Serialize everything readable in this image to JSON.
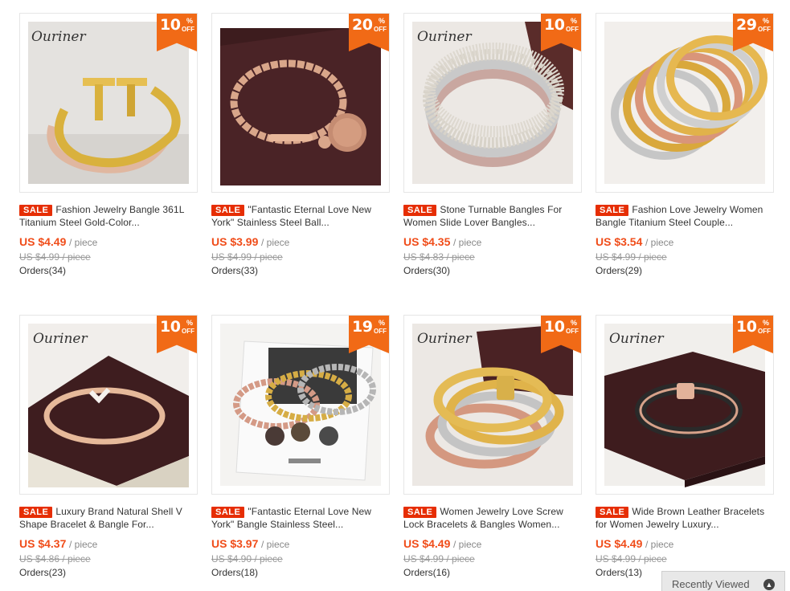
{
  "products": [
    {
      "discount": "10",
      "sale_label": "SALE",
      "title": "Fashion Jewelry Bangle 361L Titanium Steel Gold-Color...",
      "price": "US $4.49",
      "unit": "/ piece",
      "old_price": "US $4.99 / piece",
      "orders": "Orders(34)",
      "brand": "Ouriner",
      "image": "gold-t-bangle"
    },
    {
      "discount": "20",
      "sale_label": "SALE",
      "title": "\"Fantastic Eternal Love New York\" Stainless Steel Ball...",
      "price": "US $3.99",
      "unit": "/ piece",
      "old_price": "US $4.99 / piece",
      "orders": "Orders(33)",
      "brand": "",
      "image": "rose-bead-bracelet"
    },
    {
      "discount": "10",
      "sale_label": "SALE",
      "title": "Stone Turnable Bangles For Women Slide Lover Bangles...",
      "price": "US $4.35",
      "unit": "/ piece",
      "old_price": "US $4.83 / piece",
      "orders": "Orders(30)",
      "brand": "Ouriner",
      "image": "stone-bangles"
    },
    {
      "discount": "29",
      "sale_label": "SALE",
      "title": "Fashion Love Jewelry Women Bangle Titanium Steel Couple...",
      "price": "US $3.54",
      "unit": "/ piece",
      "old_price": "US $4.99 / piece",
      "orders": "Orders(29)",
      "brand": "",
      "image": "screw-bangles"
    },
    {
      "discount": "10",
      "sale_label": "SALE",
      "title": "Luxury Brand Natural Shell V Shape Bracelet & Bangle For...",
      "price": "US $4.37",
      "unit": "/ piece",
      "old_price": "US $4.86 / piece",
      "orders": "Orders(23)",
      "brand": "Ouriner",
      "image": "shell-v-bangle"
    },
    {
      "discount": "19",
      "sale_label": "SALE",
      "title": "\"Fantastic Eternal Love New York\" Bangle Stainless Steel...",
      "price": "US $3.97",
      "unit": "/ piece",
      "old_price": "US $4.90 / piece",
      "orders": "Orders(18)",
      "brand": "",
      "image": "bead-bracelets-set"
    },
    {
      "discount": "10",
      "sale_label": "SALE",
      "title": "Women Jewelry Love Screw Lock Bracelets & Bangles Women...",
      "price": "US $4.49",
      "unit": "/ piece",
      "old_price": "US $4.99 / piece",
      "orders": "Orders(16)",
      "brand": "Ouriner",
      "image": "lock-bangles"
    },
    {
      "discount": "10",
      "sale_label": "SALE",
      "title": "Wide Brown Leather Bracelets for Women Jewelry Luxury...",
      "price": "US $4.49",
      "unit": "/ piece",
      "old_price": "US $4.99 / piece",
      "orders": "Orders(13)",
      "brand": "Ouriner",
      "image": "leather-bangle"
    }
  ],
  "badge": {
    "percent": "%",
    "off": "OFF"
  },
  "recently_viewed": {
    "label": "Recently Viewed",
    "icon": "chevron-up-icon"
  },
  "colors": {
    "badge": "#f16a16",
    "sale": "#e62e04",
    "price": "#f04d1a"
  }
}
